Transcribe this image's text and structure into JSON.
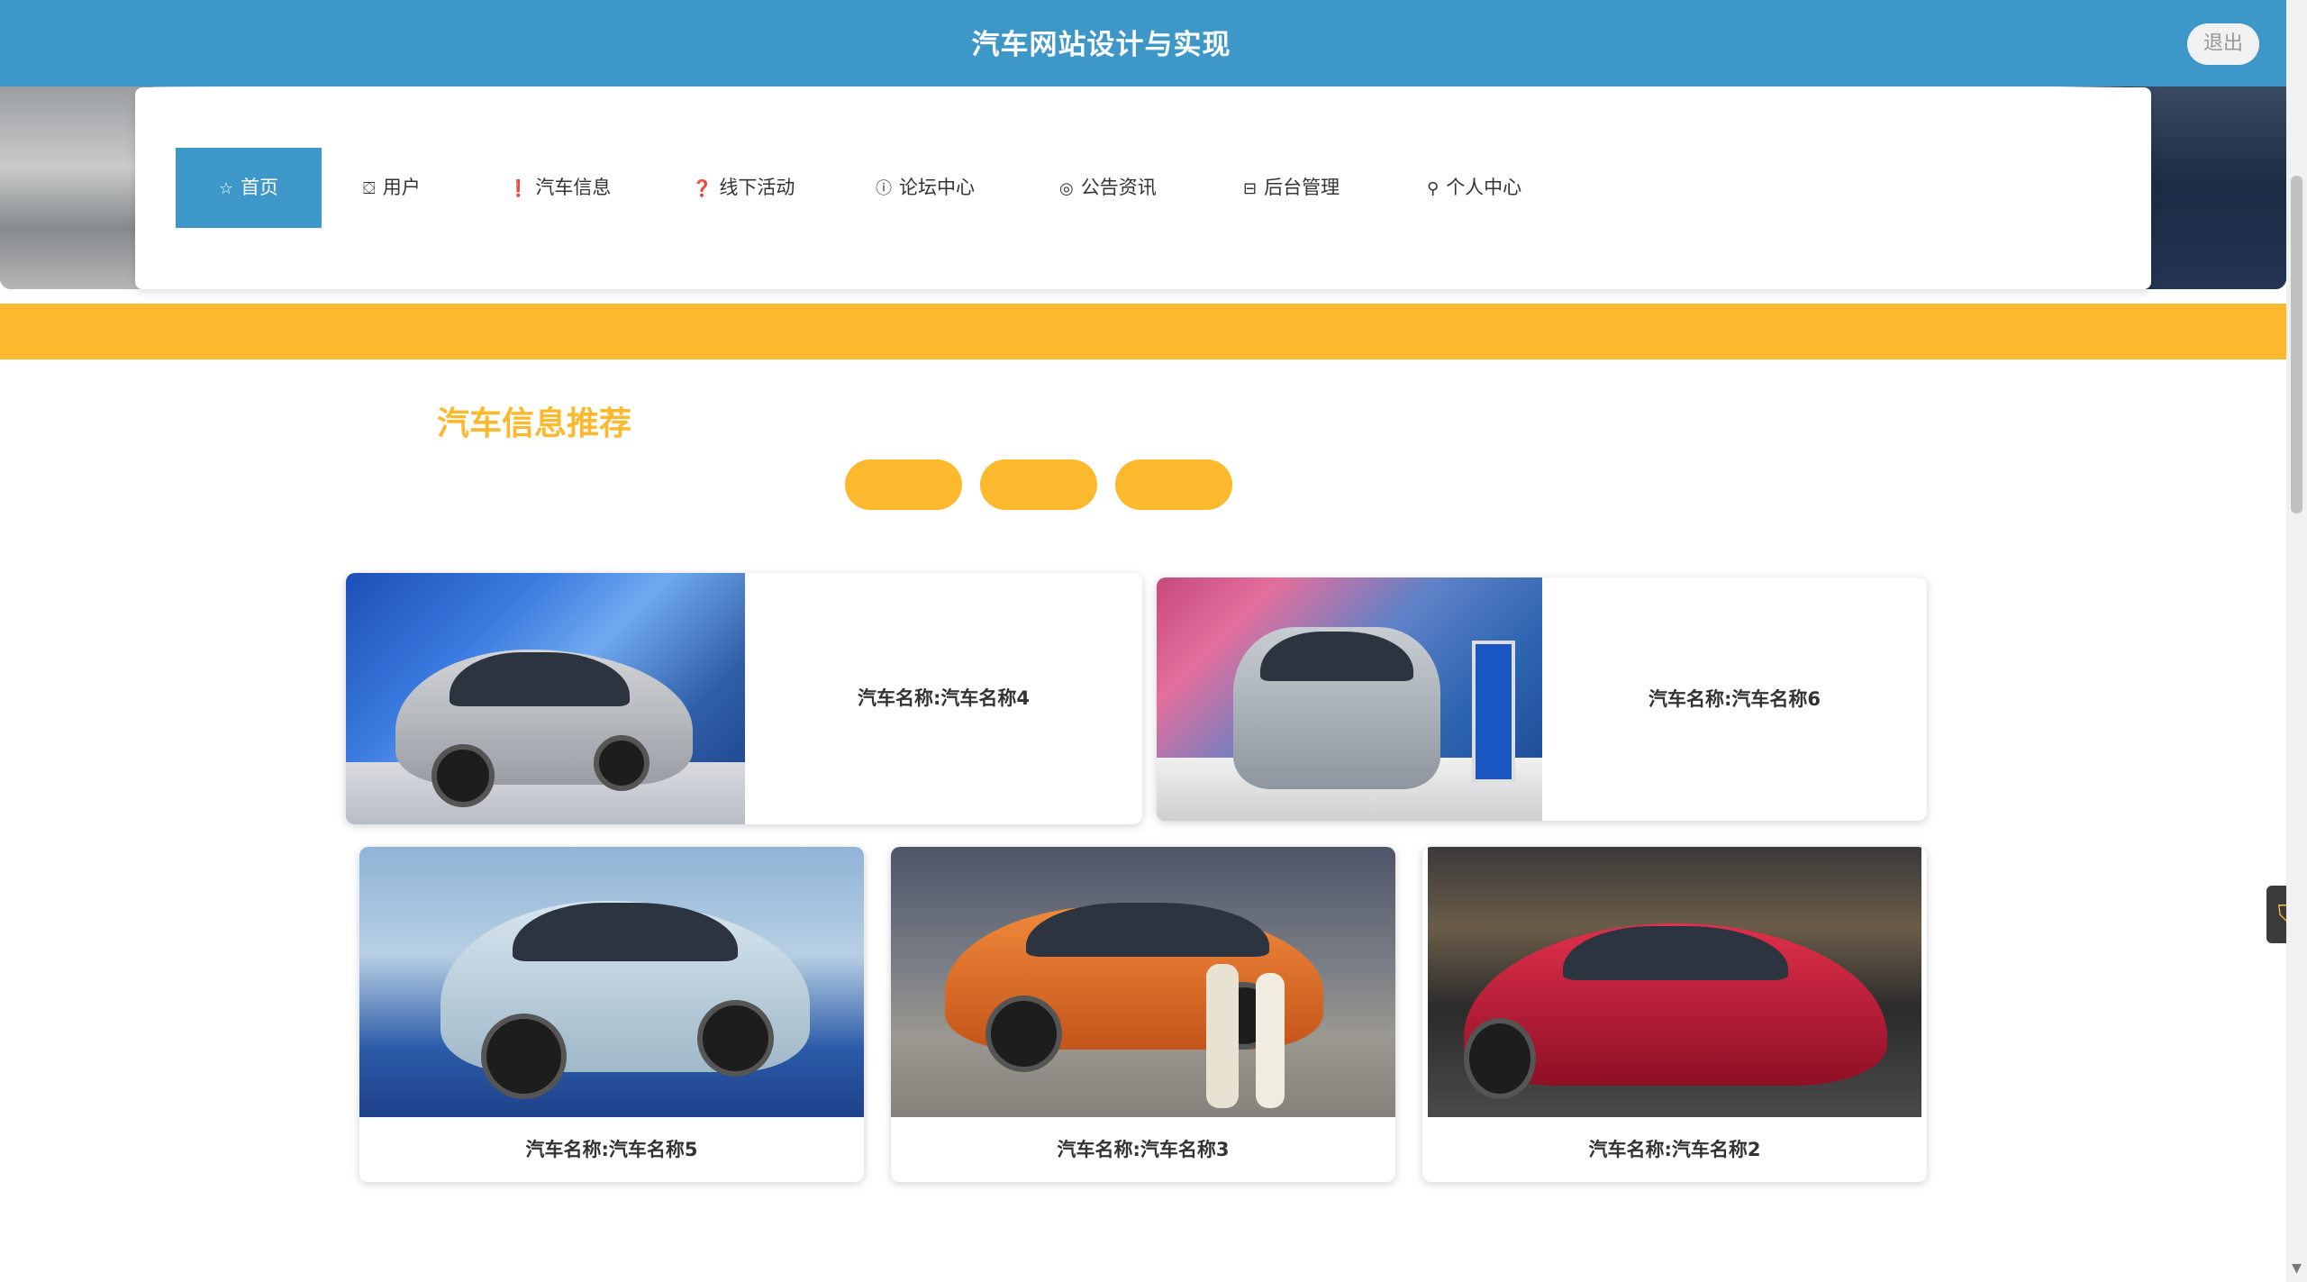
{
  "header": {
    "title": "汽车网站设计与实现",
    "logout_label": "退出"
  },
  "nav": {
    "items": [
      {
        "label": "首页",
        "icon": "star-icon",
        "active": true
      },
      {
        "label": "用户",
        "icon": "bag-icon"
      },
      {
        "label": "汽车信息",
        "icon": "exclamation-circle-icon"
      },
      {
        "label": "线下活动",
        "icon": "question-circle-icon"
      },
      {
        "label": "论坛中心",
        "icon": "info-circle-icon"
      },
      {
        "label": "公告资讯",
        "icon": "target-icon"
      },
      {
        "label": "后台管理",
        "icon": "gift-icon"
      },
      {
        "label": "个人中心",
        "icon": "user-icon"
      }
    ]
  },
  "section": {
    "title": "汽车信息推荐"
  },
  "cards": [
    {
      "caption": "汽车名称:汽车名称4"
    },
    {
      "caption": "汽车名称:汽车名称6"
    },
    {
      "caption": "汽车名称:汽车名称5"
    },
    {
      "caption": "汽车名称:汽车名称3"
    },
    {
      "caption": "汽车名称:汽车名称2"
    }
  ],
  "colors": {
    "primary": "#3d98c9",
    "accent": "#fdb92e"
  }
}
